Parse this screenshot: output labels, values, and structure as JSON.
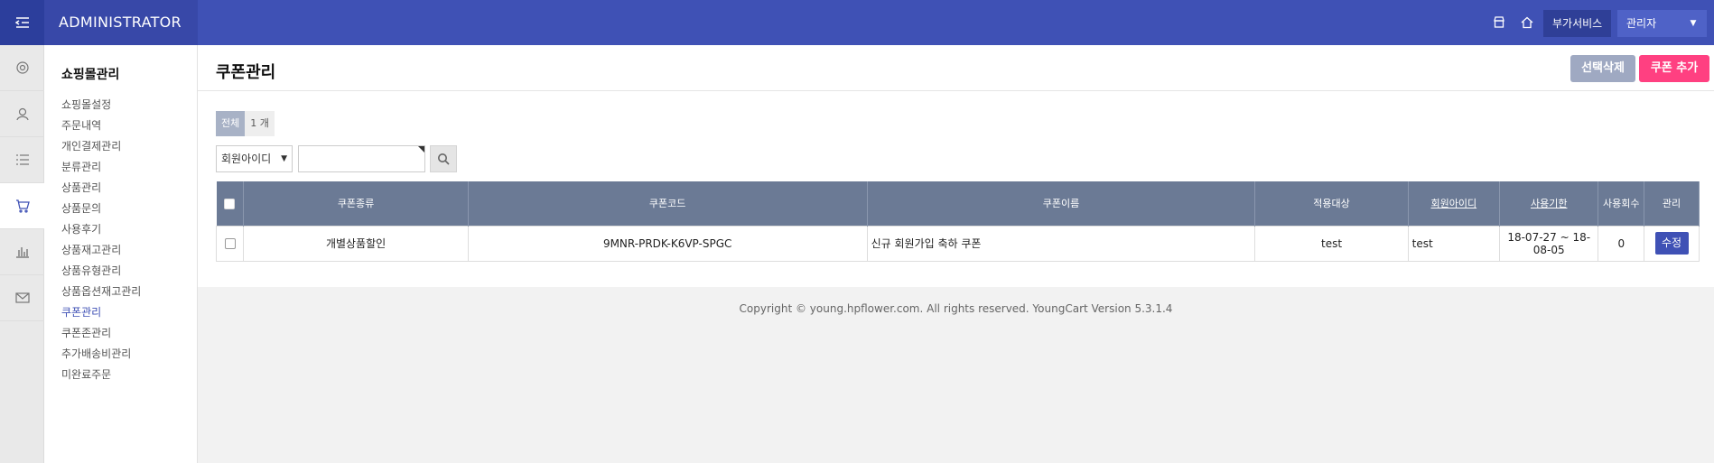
{
  "topbar": {
    "brand": "ADMINISTRATOR",
    "addon_service": "부가서비스",
    "admin": "관리자"
  },
  "colors": {
    "primary": "#3f51b5",
    "brand_bg": "#2c3e9c",
    "delete_button": "#9fa9c2",
    "add_button": "#ff4081",
    "table_header": "#6b7a95"
  },
  "rail_icons": [
    "gear-icon",
    "user-icon",
    "list-icon",
    "cart-icon",
    "chart-icon",
    "mail-icon"
  ],
  "submenu": {
    "title": "쇼핑몰관리",
    "items": [
      "쇼핑몰설정",
      "주문내역",
      "개인결제관리",
      "분류관리",
      "상품관리",
      "상품문의",
      "사용후기",
      "상품재고관리",
      "상품유형관리",
      "상품옵션재고관리",
      "쿠폰관리",
      "쿠폰존관리",
      "추가배송비관리",
      "미완료주문"
    ],
    "active": "쿠폰관리"
  },
  "page": {
    "title": "쿠폰관리",
    "delete_selected": "선택삭제",
    "add_coupon": "쿠폰 추가"
  },
  "summary": {
    "all_label": "전체",
    "count": "1 개"
  },
  "search": {
    "field_selected": "회원아이디",
    "query": ""
  },
  "table": {
    "headers": [
      "쿠폰종류",
      "쿠폰코드",
      "쿠폰이름",
      "적용대상",
      "회원아이디",
      "사용기한",
      "사용회수",
      "관리"
    ],
    "rows": [
      {
        "type": "개별상품할인",
        "code": "9MNR-PRDK-K6VP-SPGC",
        "name": "신규 회원가입 축하 쿠폰",
        "target": "test",
        "member_id": "test",
        "period": "18-07-27 ~ 18-08-05",
        "used": "0",
        "action": "수정"
      }
    ]
  },
  "footer": "Copyright © young.hpflower.com. All rights reserved. YoungCart Version 5.3.1.4"
}
